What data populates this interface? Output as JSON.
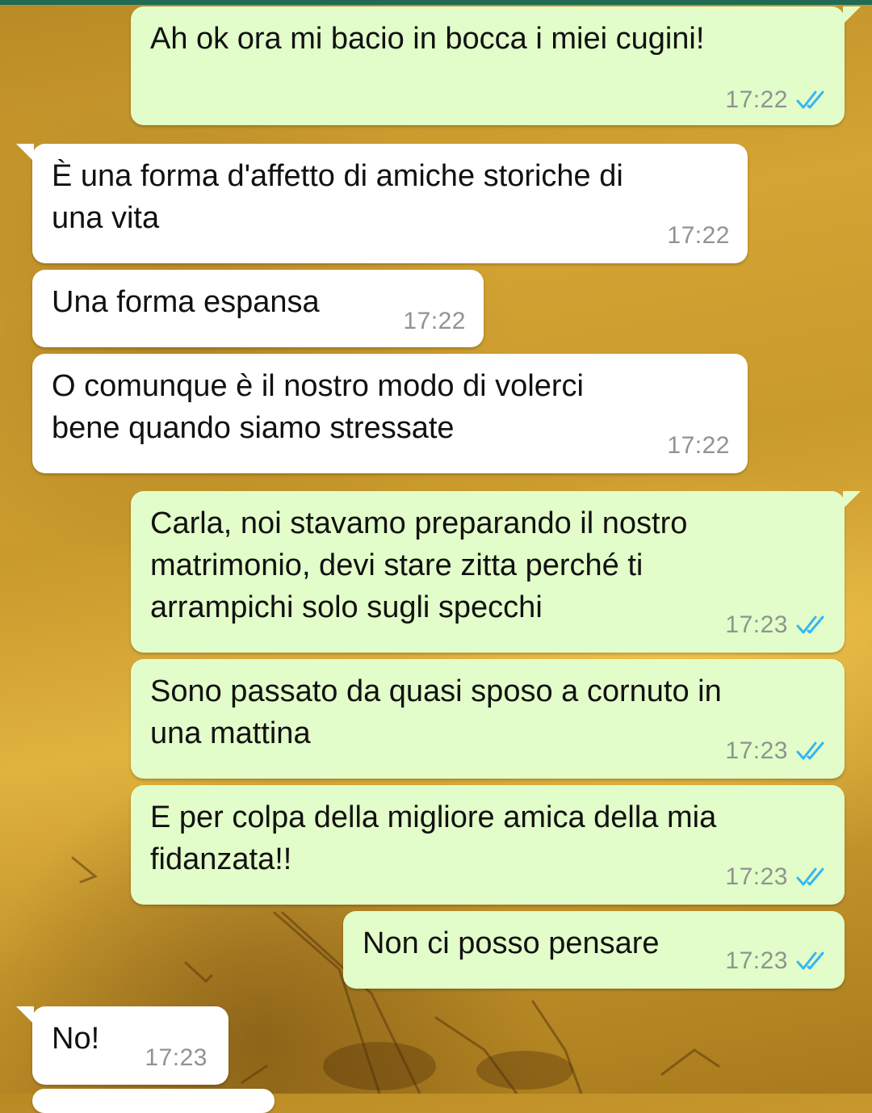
{
  "chat": {
    "messages": [
      {
        "direction": "outgoing",
        "text": "Ah ok ora mi bacio in bocca i miei cugini!",
        "time": "17:22",
        "status": "read-check-icon"
      },
      {
        "direction": "incoming",
        "text": "È una forma d'affetto di amiche storiche di\nuna vita",
        "time": "17:22"
      },
      {
        "direction": "incoming",
        "text": "Una forma espansa",
        "time": "17:22"
      },
      {
        "direction": "incoming",
        "text": "O comunque è il nostro modo di volerci\nbene quando siamo stressate",
        "time": "17:22"
      },
      {
        "direction": "outgoing",
        "text": "Carla, noi stavamo preparando il nostro\nmatrimonio, devi stare zitta perché ti\narrampichi solo sugli specchi",
        "time": "17:23",
        "status": "read-check-icon"
      },
      {
        "direction": "outgoing",
        "text": "Sono passato da quasi sposo a cornuto in\nuna mattina",
        "time": "17:23",
        "status": "read-check-icon"
      },
      {
        "direction": "outgoing",
        "text": "E per colpa della migliore amica della mia\nfidanzata!!",
        "time": "17:23",
        "status": "read-check-icon"
      },
      {
        "direction": "outgoing",
        "text": "Non ci posso pensare",
        "time": "17:23",
        "status": "read-check-icon"
      },
      {
        "direction": "incoming",
        "text": "No!",
        "time": "17:23"
      }
    ]
  },
  "colors": {
    "outgoing_bubble": "#e2fdc9",
    "incoming_bubble": "#ffffff",
    "read_check": "#34b7f1",
    "timestamp": "#8e948f"
  }
}
